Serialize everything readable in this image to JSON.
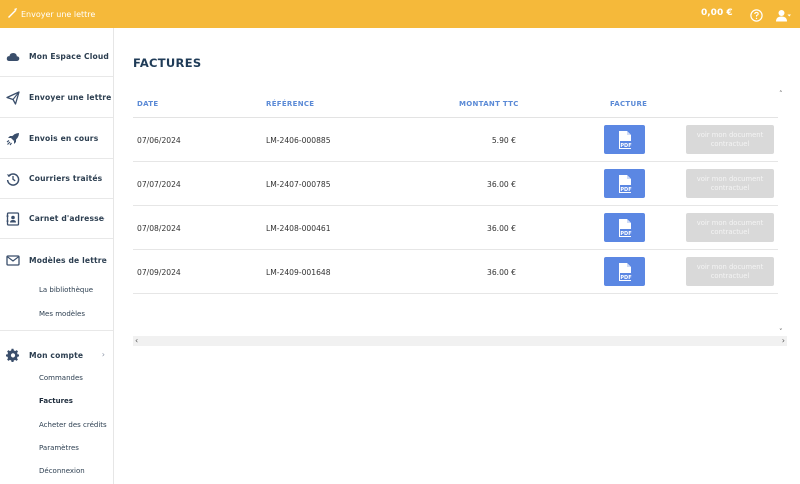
{
  "topbar": {
    "brand_label": "Envoyer une lettre",
    "balance": "0,00 €",
    "colors": {
      "bar": "#f5b93a"
    }
  },
  "sidebar": {
    "items": [
      {
        "label": "Mon Espace Cloud",
        "icon": "cloud-icon"
      },
      {
        "label": "Envoyer une lettre",
        "icon": "paper-plane-icon"
      },
      {
        "label": "Envois en cours",
        "icon": "rocket-icon"
      },
      {
        "label": "Courriers traités",
        "icon": "history-icon"
      },
      {
        "label": "Carnet d'adresse",
        "icon": "address-book-icon"
      },
      {
        "label": "Modèles de lettre",
        "icon": "envelope-icon"
      },
      {
        "label": "Mon compte",
        "icon": "gear-icon"
      }
    ],
    "modeles_sub": [
      "La bibliothèque",
      "Mes modèles"
    ],
    "compte_sub": [
      "Commandes",
      "Factures",
      "Acheter des crédits",
      "Paramètres",
      "Déconnexion"
    ]
  },
  "main": {
    "title": "FACTURES",
    "columns": [
      "DATE",
      "RÉFÉRENCE",
      "MONTANT TTC",
      "FACTURE"
    ],
    "rows": [
      {
        "date": "07/06/2024",
        "reference": "LM-2406-000885",
        "amount": "5.90 €",
        "pdf": "PDF",
        "doc": "voir mon document contractuel"
      },
      {
        "date": "07/07/2024",
        "reference": "LM-2407-000785",
        "amount": "36.00 €",
        "pdf": "PDF",
        "doc": "voir mon document contractuel"
      },
      {
        "date": "07/08/2024",
        "reference": "LM-2408-000461",
        "amount": "36.00 €",
        "pdf": "PDF",
        "doc": "voir mon document contractuel"
      },
      {
        "date": "07/09/2024",
        "reference": "LM-2409-001648",
        "amount": "36.00 €",
        "pdf": "PDF",
        "doc": "voir mon document contractuel"
      }
    ]
  }
}
